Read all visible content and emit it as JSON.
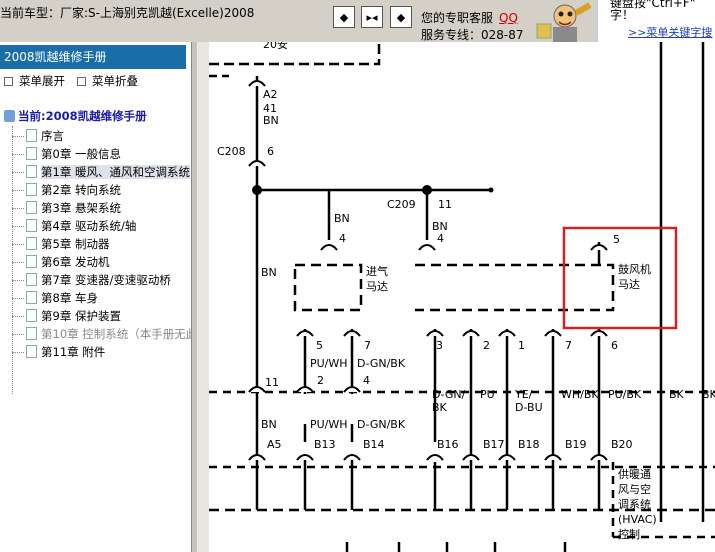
{
  "topbar": {
    "vehicle_label": "当前车型：厂家:S-上海别克凯越(Excelle)2008",
    "nav_first": "◆",
    "nav_middle": "▸◂",
    "nav_last": "◆",
    "support_line": "您的专职客服",
    "support_qq": "QQ",
    "hotline": "服务专线：028-87",
    "hint_line1": "键盘按\"Ctrl+F\"",
    "hint_line2": "字！",
    "hint_link": ">>菜单关键字搜"
  },
  "sidebar": {
    "header": "2008凯越维修手册",
    "expand_label": "菜单展开",
    "collapse_label": "菜单折叠",
    "root_label": "当前:2008凯越维修手册",
    "items": [
      {
        "label": "序言"
      },
      {
        "label": "第0章 一般信息"
      },
      {
        "label": "第1章 暖风、通风和空调系统"
      },
      {
        "label": "第2章 转向系统"
      },
      {
        "label": "第3章 悬架系统"
      },
      {
        "label": "第4章 驱动系统/轴"
      },
      {
        "label": "第5章 制动器"
      },
      {
        "label": "第6章 发动机"
      },
      {
        "label": "第7章 变速器/变速驱动桥"
      },
      {
        "label": "第8章 车身"
      },
      {
        "label": "第9章 保护装置"
      },
      {
        "label": "第10章 控制系统（本手册无此"
      },
      {
        "label": "第11章 附件"
      }
    ],
    "selected_index": 2
  },
  "diagram": {
    "top_partial": "20安",
    "a2": {
      "pin": "A2",
      "circuit": "41",
      "color": "BN"
    },
    "c208": {
      "name": "C208",
      "pin": "6"
    },
    "c209": {
      "name": "C209",
      "pin": "11"
    },
    "intake_motor": {
      "line1": "进气",
      "line2": "马达",
      "pin_top": "4",
      "wire_top": "BN",
      "pin_left": "5",
      "pin_right": "7"
    },
    "right_upper": {
      "pin_top": "4",
      "wire_top": "BN",
      "pins": [
        "3",
        "2",
        "1",
        "7",
        "6"
      ]
    },
    "blower_motor": {
      "line1": "鼓风机",
      "line2": "马达",
      "pin": "5"
    },
    "left_bn": "BN",
    "wire_pu_wh": "PU/WH",
    "wire_d_gn_bk": "D-GN/BK",
    "conn_mid": {
      "pin_left": "11",
      "pin_b": "2",
      "pin_c": "4"
    },
    "right_wires": {
      "w3_l1": "D-GN/",
      "w3_l2": "BK",
      "w2": "PU",
      "w1_l1": "YE/",
      "w1_l2": "D-BU",
      "w7": "WH/BK",
      "w6": "PU/BK",
      "bk1": "BK",
      "bk2": "BK"
    },
    "lower_wires": {
      "bn": "BN",
      "pu_wh": "PU/WH",
      "d_gn_bk": "D-GN/BK"
    },
    "bottom_pins": [
      "A5",
      "B13",
      "B14",
      "B16",
      "B17",
      "B18",
      "B19",
      "B20"
    ],
    "hvac_label": [
      "供暖通",
      "风与空",
      "调系统",
      "(HVAC)",
      "控制"
    ],
    "highlight_color": "#d42020"
  }
}
